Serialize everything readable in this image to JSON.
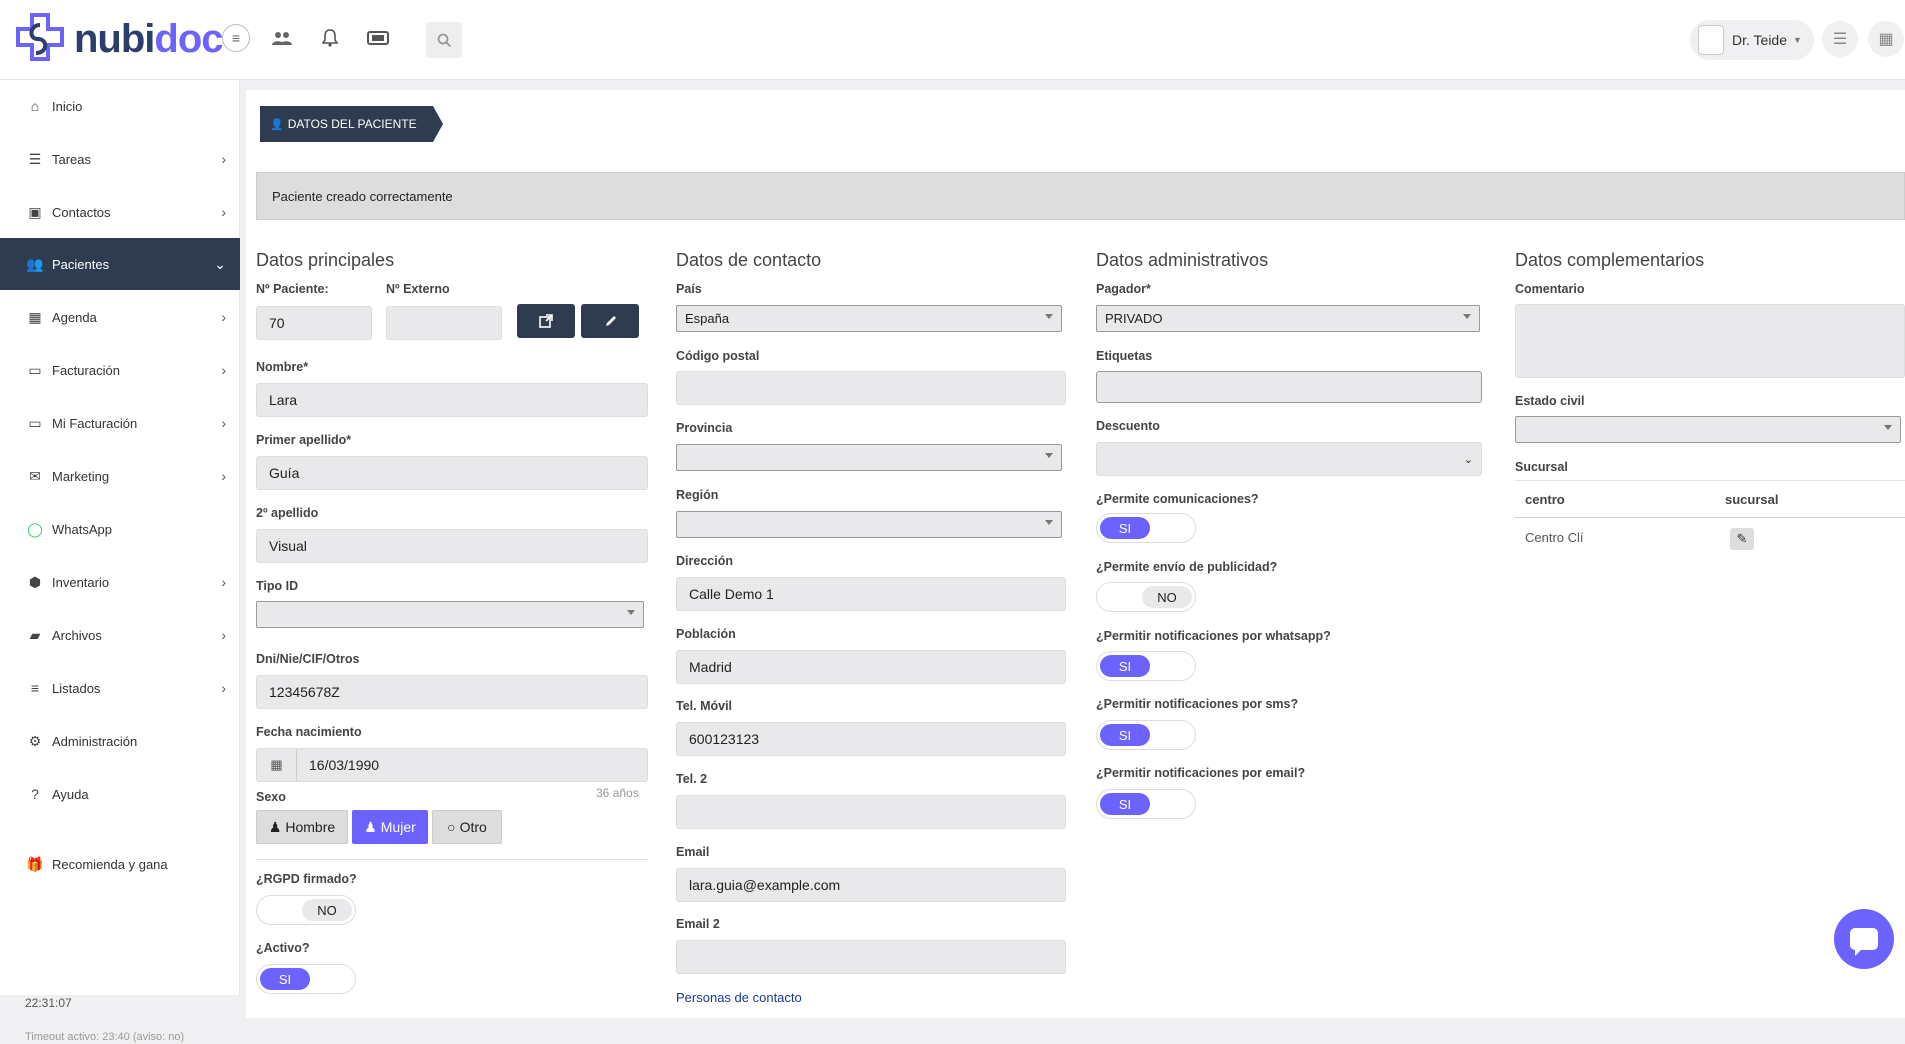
{
  "header": {
    "logo_text_a": "nubi",
    "logo_text_b": "doc",
    "user_name": "Dr. Teide",
    "icons": [
      "menu-toggle-icon",
      "users-icon",
      "bell-icon",
      "ticket-icon",
      "search-icon",
      "hamburger-icon",
      "calendar-icon"
    ]
  },
  "sidebar": {
    "items": [
      {
        "label": "Inicio",
        "icon": "home-icon",
        "chevron": false
      },
      {
        "label": "Tareas",
        "icon": "list-icon",
        "chevron": true
      },
      {
        "label": "Contactos",
        "icon": "address-book-icon",
        "chevron": true
      },
      {
        "label": "Pacientes",
        "icon": "users-icon",
        "chevron": true,
        "active": true
      },
      {
        "label": "Agenda",
        "icon": "calendar-icon",
        "chevron": true
      },
      {
        "label": "Facturación",
        "icon": "money-icon",
        "chevron": true
      },
      {
        "label": "Mi Facturación",
        "icon": "money-icon",
        "chevron": true
      },
      {
        "label": "Marketing",
        "icon": "envelope-icon",
        "chevron": true
      },
      {
        "label": "WhatsApp",
        "icon": "whatsapp-icon",
        "chevron": false
      },
      {
        "label": "Inventario",
        "icon": "cubes-icon",
        "chevron": true
      },
      {
        "label": "Archivos",
        "icon": "folder-icon",
        "chevron": true
      },
      {
        "label": "Listados",
        "icon": "chart-list-icon",
        "chevron": true
      },
      {
        "label": "Administración",
        "icon": "gear-icon",
        "chevron": false
      },
      {
        "label": "Ayuda",
        "icon": "question-icon",
        "chevron": false
      },
      {
        "label": "Recomienda y gana",
        "icon": "gift-icon",
        "chevron": false
      }
    ],
    "time": "22:31:07",
    "timeout": "Timeout activo: 23:40 (aviso: no)"
  },
  "main": {
    "breadcrumb": "DATOS DEL PACIENTE",
    "alert": "Paciente creado correctamente",
    "principales": {
      "title": "Datos principales",
      "n_paciente_label": "Nº Paciente:",
      "n_paciente_value": "70",
      "n_externo_label": "Nº Externo",
      "n_externo_value": "",
      "nombre_label": "Nombre*",
      "nombre_value": "Lara",
      "apellido1_label": "Primer apellido*",
      "apellido1_value": "Guía",
      "apellido2_label": "2º apellido",
      "apellido2_value": "Visual",
      "tipo_id_label": "Tipo ID",
      "tipo_id_value": "",
      "dni_label": "Dni/Nie/CIF/Otros",
      "dni_value": "12345678Z",
      "fecha_label": "Fecha nacimiento",
      "fecha_value": "16/03/1990",
      "edad": "36 años",
      "sexo_label": "Sexo",
      "sexo_options": [
        "Hombre",
        "Mujer",
        "Otro"
      ],
      "sexo_selected": "Mujer",
      "rgpd_label": "¿RGPD firmado?",
      "rgpd_value": "NO",
      "activo_label": "¿Activo?",
      "activo_value": "SI"
    },
    "contacto": {
      "title": "Datos de contacto",
      "pais_label": "País",
      "pais_value": "España",
      "cp_label": "Código postal",
      "cp_value": "",
      "provincia_label": "Provincia",
      "provincia_value": "",
      "region_label": "Región",
      "region_value": "",
      "direccion_label": "Dirección",
      "direccion_value": "Calle Demo 1",
      "poblacion_label": "Población",
      "poblacion_value": "Madrid",
      "movil_label": "Tel. Móvil",
      "movil_value": "600123123",
      "tel2_label": "Tel. 2",
      "tel2_value": "",
      "email_label": "Email",
      "email_value": "lara.guia@example.com",
      "email2_label": "Email 2",
      "email2_value": "",
      "personas_link": "Personas de contacto"
    },
    "administrativos": {
      "title": "Datos administrativos",
      "pagador_label": "Pagador*",
      "pagador_value": "PRIVADO",
      "etiquetas_label": "Etiquetas",
      "etiquetas_value": "",
      "descuento_label": "Descuento",
      "descuento_value": "",
      "comunicaciones_label": "¿Permite comunicaciones?",
      "comunicaciones_value": "SI",
      "publicidad_label": "¿Permite envío de publicidad?",
      "publicidad_value": "NO",
      "whatsapp_label": "¿Permitir notificaciones por whatsapp?",
      "whatsapp_value": "SI",
      "sms_label": "¿Permitir notificaciones por sms?",
      "sms_value": "SI",
      "email_label": "¿Permitir notificaciones por email?",
      "email_value": "SI"
    },
    "complementarios": {
      "title": "Datos complementarios",
      "comentario_label": "Comentario",
      "estado_civil_label": "Estado civil",
      "estado_civil_value": "",
      "sucursal_label": "Sucursal",
      "table_headers": [
        "centro",
        "sucursal"
      ],
      "table_rows": [
        {
          "centro": "Centro Clí",
          "sucursal": ""
        }
      ]
    }
  }
}
